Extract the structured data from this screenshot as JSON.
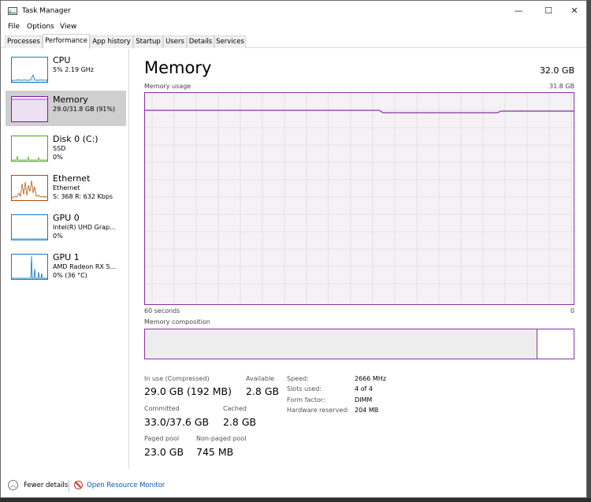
{
  "window": {
    "title": "Task Manager",
    "minimize_glyph": "—",
    "maximize_glyph": "☐",
    "close_glyph": "✕"
  },
  "menu": [
    "File",
    "Options",
    "View"
  ],
  "tabs": [
    "Processes",
    "Performance",
    "App history",
    "Startup",
    "Users",
    "Details",
    "Services"
  ],
  "active_tab": "Performance",
  "sidebar": {
    "items": [
      {
        "title": "CPU",
        "line1": "5%  2.19 GHz",
        "line2": "",
        "color": "#117dbb"
      },
      {
        "title": "Memory",
        "line1": "29.0/31.8 GB (91%)",
        "line2": "",
        "color": "#8b12ae"
      },
      {
        "title": "Disk 0 (C:)",
        "line1": "SSD",
        "line2": "0%",
        "color": "#4da60c"
      },
      {
        "title": "Ethernet",
        "line1": "Ethernet",
        "line2": "S: 368  R: 632 Kbps",
        "color": "#a74f01"
      },
      {
        "title": "GPU 0",
        "line1": "Intel(R) UHD Grap...",
        "line2": "0%",
        "color": "#117dbb"
      },
      {
        "title": "GPU 1",
        "line1": "AMD Radeon RX 5...",
        "line2": "0%  (36 °C)",
        "color": "#117dbb"
      }
    ]
  },
  "memory": {
    "title": "Memory",
    "total": "32.0 GB",
    "usage_label": "Memory usage",
    "usage_max": "31.8 GB",
    "time_left": "60 seconds",
    "time_right": "0",
    "composition_label": "Memory composition",
    "in_use_fraction": 0.91,
    "stats": {
      "in_use_label": "In use (Compressed)",
      "in_use_value": "29.0 GB (192 MB)",
      "available_label": "Available",
      "available_value": "2.8 GB",
      "committed_label": "Committed",
      "committed_value": "33.0/37.6 GB",
      "cached_label": "Cached",
      "cached_value": "2.8 GB",
      "paged_label": "Paged pool",
      "paged_value": "23.0 GB",
      "nonpaged_label": "Non-paged pool",
      "nonpaged_value": "745 MB"
    },
    "specs": {
      "speed_label": "Speed:",
      "speed_value": "2666 MHz",
      "slots_label": "Slots used:",
      "slots_value": "4 of 4",
      "form_label": "Form factor:",
      "form_value": "DIMM",
      "reserved_label": "Hardware reserved:",
      "reserved_value": "204 MB"
    }
  },
  "footer": {
    "fewer_details": "Fewer details",
    "fewer_glyph": "︿",
    "resource_monitor": "Open Resource Monitor"
  },
  "colors": {
    "memory_accent": "#8b2fa9",
    "link": "#0a57b5"
  }
}
